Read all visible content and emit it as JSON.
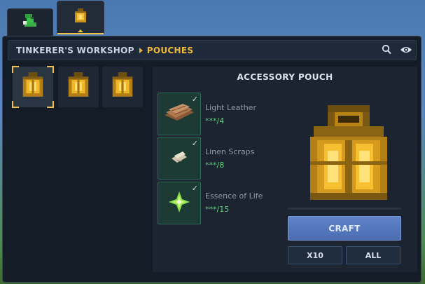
{
  "tabs": [
    {
      "icon": "boot-icon",
      "active": false
    },
    {
      "icon": "pouch-icon",
      "active": true
    }
  ],
  "header": {
    "breadcrumb_root": "TINKERER'S WORKSHOP",
    "breadcrumb_current": "POUCHES",
    "accent": "#f0b93a"
  },
  "recipe_list": [
    {
      "icon": "pouch-icon",
      "selected": true
    },
    {
      "icon": "pouch-icon",
      "selected": false
    },
    {
      "icon": "pouch-icon",
      "selected": false
    }
  ],
  "detail": {
    "title": "ACCESSORY POUCH",
    "ingredients": [
      {
        "name": "Light Leather",
        "count": "***/4",
        "icon": "leather-icon",
        "checked": true
      },
      {
        "name": "Linen Scraps",
        "count": "***/8",
        "icon": "linen-scraps-icon",
        "checked": true
      },
      {
        "name": "Essence of Life",
        "count": "***/15",
        "icon": "essence-icon",
        "checked": true
      }
    ],
    "craft_label": "CRAFT",
    "x10_label": "X10",
    "all_label": "ALL"
  },
  "colors": {
    "craft_button": "#5a7dc2",
    "count_text": "#5cd07a",
    "selection_highlight": "#f2c14a"
  }
}
